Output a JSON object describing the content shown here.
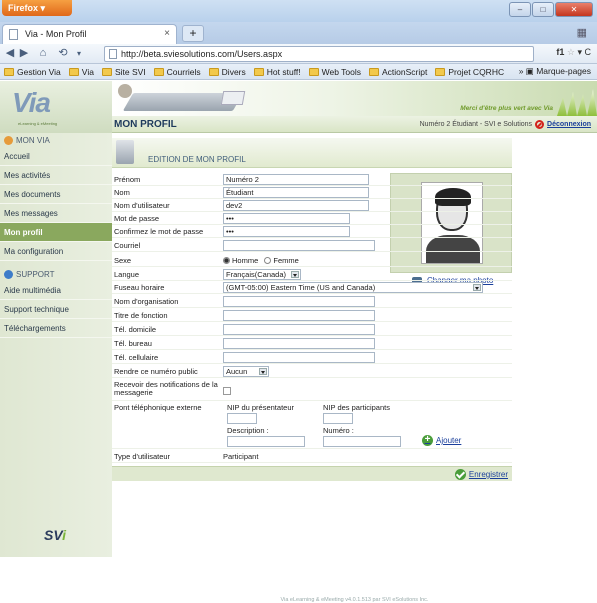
{
  "browser": {
    "menu_label": "Firefox",
    "tab_title": "Via - Mon Profil",
    "url": "http://beta.sviesolutions.com/Users.aspx",
    "new_tab": "+",
    "bookmarks": [
      "Gestion Via",
      "Via",
      "Site SVI",
      "Courriels",
      "Divers",
      "Hot stuff!",
      "Web Tools",
      "ActionScript",
      "Projet CQRHC"
    ],
    "bookmarks_menu": "Marque-pages",
    "search_label": "f1"
  },
  "branding": {
    "logo": "Via",
    "logo_sub": "eLearning & eMeeting",
    "slogan": "Merci d'être plus vert avec Via",
    "svi_logo_a": "SV",
    "svi_logo_b": "i"
  },
  "header": {
    "page_title": "MON PROFIL",
    "user_info": "Numéro 2 Étudiant - SVI e Solutions",
    "logout": "Déconnexion"
  },
  "sidebar": {
    "sections": [
      {
        "title": "MON VIA",
        "items": [
          "Accueil",
          "Mes activités",
          "Mes documents",
          "Mes messages",
          "Mon profil",
          "Ma configuration"
        ]
      },
      {
        "title": "SUPPORT",
        "items": [
          "Aide multimédia",
          "Support technique",
          "Téléchargements"
        ]
      }
    ],
    "active_item": "Mon profil"
  },
  "form": {
    "section_title": "EDITION DE MON PROFIL",
    "fields": {
      "prenom": {
        "label": "Prénom",
        "value": "Numéro 2"
      },
      "nom": {
        "label": "Nom",
        "value": "Étudiant"
      },
      "username": {
        "label": "Nom d'utilisateur",
        "value": "dev2"
      },
      "password": {
        "label": "Mot de passe",
        "value": "•••"
      },
      "confirm_password": {
        "label": "Confirmez le mot de passe",
        "value": "•••"
      },
      "courriel": {
        "label": "Courriel",
        "value": ""
      },
      "sexe": {
        "label": "Sexe",
        "options": [
          "Homme",
          "Femme"
        ],
        "selected": "Homme"
      },
      "langue": {
        "label": "Langue",
        "value": "Français(Canada)"
      },
      "fuseau": {
        "label": "Fuseau horaire",
        "value": "(GMT-05:00) Eastern Time (US and Canada)"
      },
      "organisation": {
        "label": "Nom d'organisation",
        "value": ""
      },
      "titre": {
        "label": "Titre de fonction",
        "value": ""
      },
      "tel_domicile": {
        "label": "Tél. domicile",
        "value": ""
      },
      "tel_bureau": {
        "label": "Tél. bureau",
        "value": ""
      },
      "tel_cellulaire": {
        "label": "Tél. cellulaire",
        "value": ""
      },
      "numero_public": {
        "label": "Rendre ce numéro public",
        "value": "Aucun"
      },
      "notifications": {
        "label": "Recevoir des notifications de la messagerie",
        "checked": false
      },
      "pont": {
        "label": "Pont téléphonique externe",
        "nip_presentateur": "NIP du présentateur",
        "nip_participants": "NIP des participants",
        "description": "Description :",
        "numero": "Numéro :",
        "add_label": "Ajouter"
      },
      "type_utilisateur": {
        "label": "Type d'utilisateur",
        "value": "Participant"
      }
    },
    "change_photo": "Changer ma photo",
    "save": "Enregistrer"
  },
  "footer": "Via eLearning & eMeeting v4.0.1.513 par SVI eSolutions Inc."
}
